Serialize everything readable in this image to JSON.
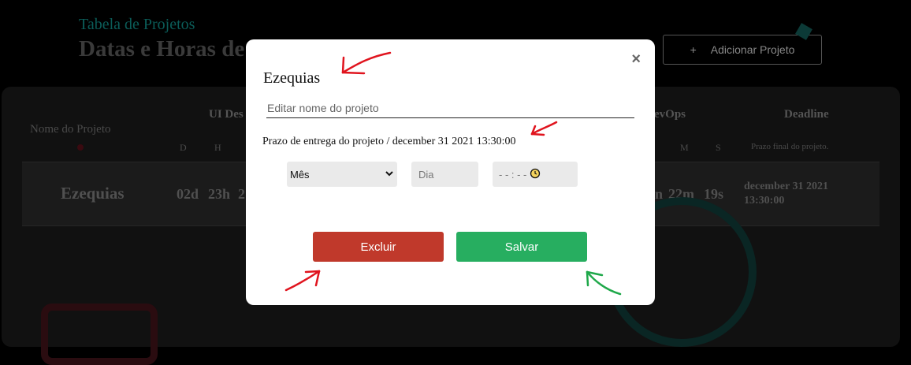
{
  "background": {
    "title_sub": "Tabela de Projetos",
    "title_main": "Datas e Horas de",
    "add_button": {
      "icon": "+",
      "label": "Adicionar Projeto"
    },
    "table": {
      "headers": {
        "name": "Nome do Projeto",
        "ui": "UI Des",
        "devops": "evOps",
        "deadline": "Deadline"
      },
      "sub_headers": {
        "ui": [
          "D",
          "H"
        ],
        "devops": [
          "M",
          "S"
        ],
        "deadline": "Prazo final do projeto."
      },
      "row": {
        "name": "Ezequias",
        "ui_d": "02d",
        "ui_h": "23h",
        "ui_m_partial": "2",
        "devops_partial": "n",
        "devops_m": "22m",
        "devops_s": "19s",
        "deadline_line1": "december 31 2021",
        "deadline_line2": "13:30:00"
      }
    }
  },
  "modal": {
    "close_label": "×",
    "title": "Ezequias",
    "name_placeholder": "Editar nome do projeto",
    "deadline_text": "Prazo de entrega do projeto / december 31 2021 13:30:00",
    "month_select": "Mês",
    "day_placeholder": "Dia",
    "time_placeholder": "- - : - -",
    "delete_label": "Excluir",
    "save_label": "Salvar"
  },
  "colors": {
    "delete": "#c0392b",
    "save": "#27ae60",
    "annotation_red": "#e0141e",
    "annotation_green": "#1fa84a"
  }
}
